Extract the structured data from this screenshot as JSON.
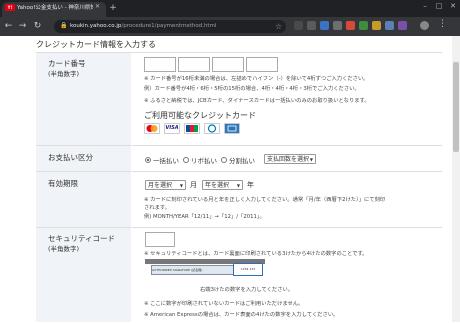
{
  "browser": {
    "tab_title": "Yahoo!公金支払い - 神奈川県知",
    "tab_favicon": "Y!",
    "url_host": "koukin.yahoo.co.jp",
    "url_path": "/procedure1/paymentmethod.html",
    "icons": [
      "back-arrow-icon",
      "forward-arrow-icon",
      "reload-icon",
      "lock-icon",
      "star-icon",
      "close-icon",
      "new-tab-icon",
      "minimize-icon",
      "maximize-icon"
    ]
  },
  "page": {
    "section_title": "クレジットカード情報を入力する",
    "card_number": {
      "label": "カード番号",
      "sub": "(半角数字)",
      "notes": [
        "※ カード番号が16桁未満の場合は、左詰めでハイフン（-）を除いて4桁ずつご入力ください。",
        "例）カード番号が4桁・6桁・5桁の15桁の場合、4桁・4桁・4桁・3桁でご入力ください。",
        "※ ふるさと納税では、JCBカード、ダイナースカードは一括払いのみのお取り扱いとなります。"
      ],
      "brands_title": "ご利用可能なクレジットカード",
      "brands": [
        "MasterCard",
        "VISA",
        "JCB",
        "Diners Club",
        "American Express"
      ]
    },
    "payment": {
      "label": "お支払い区分",
      "options": [
        "一括払い",
        "リボ払い",
        "分割払い"
      ],
      "selected": "一括払い",
      "installment_placeholder": "支払回数を選択"
    },
    "expiry": {
      "label": "有効期限",
      "month_placeholder": "月を選択",
      "month_unit": "月",
      "year_placeholder": "年を選択",
      "year_unit": "年",
      "notes": [
        "※ カードに刻印されている月と年を正しく入力してください。通常「月/年（西暦下2けた）」にて刻印",
        "されます。",
        "例) MONTH/YEAR「12/11」→「12」/「2011」。"
      ]
    },
    "security": {
      "label": "セキュリティコード",
      "sub": "(半角数字)",
      "notes": [
        "※ セキュリティコードとは、カード裏面に印刷されている3けたから4けたの数字のことです。",
        "※ ここに数字が印刷されていないカードはご利用いただけません。",
        "※ American Expressの場合は、カード表面の4けたの数字を入力してください。"
      ],
      "image_caption": "右端3けたの数字を入力してください。",
      "image_text": "AUTHORIZED SIGNATURE (記名欄)",
      "image_digits": "1234 123"
    }
  },
  "colors": {
    "tabbar": "#202124",
    "toolbar": "#35363a",
    "label_bg": "#f0f3f7",
    "border": "#dddddd"
  }
}
